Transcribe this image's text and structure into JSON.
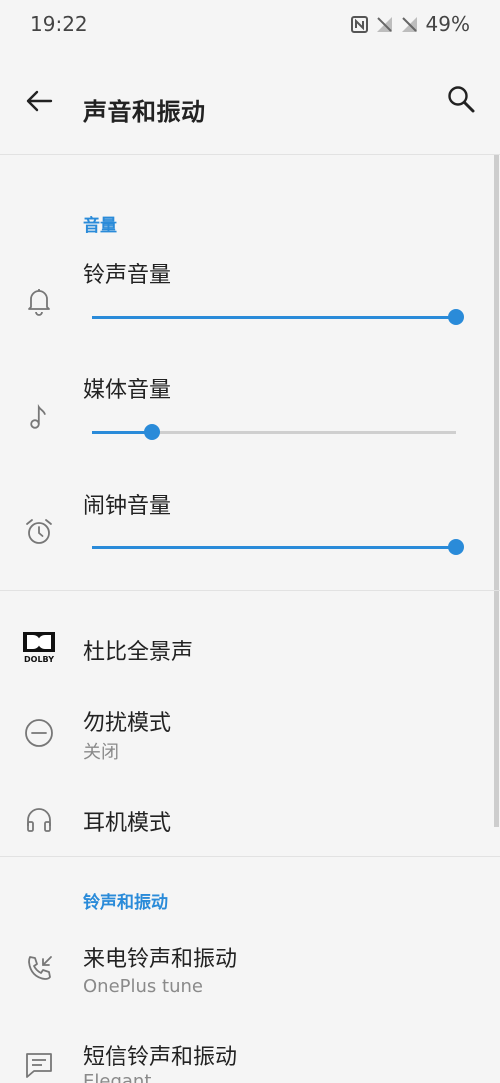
{
  "status": {
    "time": "19:22",
    "battery": "49%"
  },
  "header": {
    "title": "声音和振动"
  },
  "volume": {
    "section_title": "音量",
    "items": [
      {
        "label": "铃声音量",
        "level": 1.0
      },
      {
        "label": "媒体音量",
        "level": 0.165
      },
      {
        "label": "闹钟音量",
        "level": 1.0
      }
    ]
  },
  "settings": {
    "items": [
      {
        "label": "杜比全景声",
        "icon_text": "DOLBY"
      },
      {
        "label": "勿扰模式",
        "sub": "关闭"
      },
      {
        "label": "耳机模式"
      }
    ]
  },
  "ringtones": {
    "section_title": "铃声和振动",
    "items": [
      {
        "label": "来电铃声和振动",
        "sub": "OnePlus tune"
      },
      {
        "label": "短信铃声和振动",
        "sub": "Elegant"
      }
    ]
  },
  "colors": {
    "accent": "#2a8bd9",
    "track": "#cfcfcf",
    "background": "#f5f5f5"
  }
}
